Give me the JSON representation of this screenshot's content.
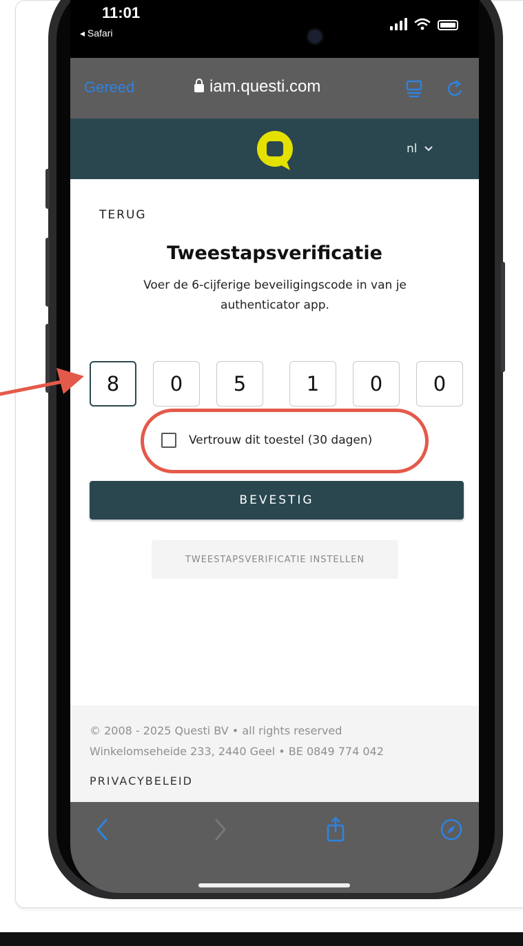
{
  "status_bar": {
    "time": "11:01",
    "back_app": "◂ Safari"
  },
  "browser": {
    "done_label": "Gereed",
    "url": "iam.questi.com"
  },
  "site_header": {
    "language": "nl"
  },
  "page": {
    "back_label": "TERUG",
    "title": "Tweestapsverificatie",
    "subtitle": "Voer de 6-cijferige beveiligingscode in van je authenticator app.",
    "code_digits": [
      "8",
      "0",
      "5",
      "1",
      "0",
      "0"
    ],
    "trust_label": "Vertrouw dit toestel (30 dagen)",
    "trust_checked": false,
    "confirm_label": "BEVESTIG",
    "setup_label": "TWEESTAPSVERIFICATIE INSTELLEN"
  },
  "footer": {
    "copyright": "© 2008 - 2025 Questi BV • all rights reserved",
    "address": "Winkelomseheide 233, 2440 Geel • BE 0849 774 042",
    "privacy_label": "PRIVACYBELEID"
  },
  "colors": {
    "header_bg": "#2a4750",
    "brand_yellow": "#e4e000",
    "safari_blue": "#2f82e0",
    "annotation_red": "#e45a4a"
  },
  "icons": [
    "lock-icon",
    "reader-icon",
    "reload-icon",
    "questi-logo",
    "chevron-down-icon",
    "back-icon",
    "forward-icon",
    "share-icon",
    "compass-icon"
  ]
}
